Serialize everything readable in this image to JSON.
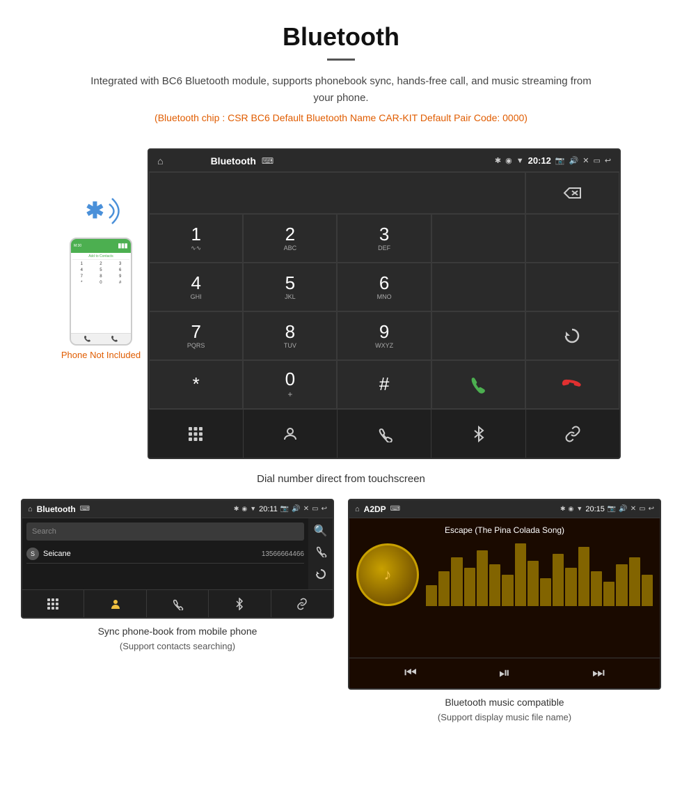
{
  "header": {
    "title": "Bluetooth",
    "description": "Integrated with BC6 Bluetooth module, supports phonebook sync, hands-free call, and music streaming from your phone.",
    "specs": "(Bluetooth chip : CSR BC6    Default Bluetooth Name CAR-KIT    Default Pair Code: 0000)"
  },
  "phone_mockup": {
    "not_included_label": "Phone Not Included",
    "dialpad_keys": [
      "1",
      "2",
      "3",
      "4",
      "5",
      "6",
      "7",
      "8",
      "9",
      "*",
      "0",
      "#"
    ],
    "contact_label": "Add to Contacts"
  },
  "head_unit": {
    "status_bar": {
      "title": "Bluetooth",
      "time": "20:12",
      "usb_icon": "⌨"
    },
    "keys": [
      {
        "num": "1",
        "letters": "∿∿"
      },
      {
        "num": "2",
        "letters": "ABC"
      },
      {
        "num": "3",
        "letters": "DEF"
      },
      {
        "num": "4",
        "letters": "GHI"
      },
      {
        "num": "5",
        "letters": "JKL"
      },
      {
        "num": "6",
        "letters": "MNO"
      },
      {
        "num": "7",
        "letters": "PQRS"
      },
      {
        "num": "8",
        "letters": "TUV"
      },
      {
        "num": "9",
        "letters": "WXYZ"
      },
      {
        "num": "*",
        "letters": ""
      },
      {
        "num": "0",
        "letters": "+"
      },
      {
        "num": "#",
        "letters": ""
      }
    ]
  },
  "dial_caption": "Dial number direct from touchscreen",
  "phonebook_screen": {
    "status_bar_title": "Bluetooth",
    "time": "20:11",
    "search_placeholder": "Search",
    "contact_name": "Seicane",
    "contact_letter": "S",
    "contact_number": "13566664466"
  },
  "music_screen": {
    "status_bar_title": "A2DP",
    "time": "20:15",
    "song_title": "Escape (The Pina Colada Song)",
    "eq_bars": [
      30,
      50,
      70,
      55,
      80,
      60,
      45,
      90,
      65,
      40,
      75,
      55,
      85,
      50,
      35,
      60,
      70,
      45
    ]
  },
  "captions": {
    "phonebook": "Sync phone-book from mobile phone",
    "phonebook_sub": "(Support contacts searching)",
    "music": "Bluetooth music compatible",
    "music_sub": "(Support display music file name)"
  }
}
